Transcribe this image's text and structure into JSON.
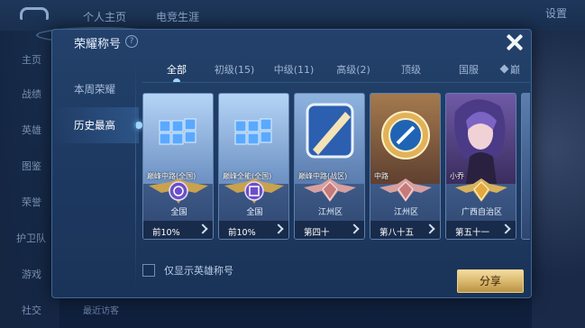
{
  "background": {
    "tabs": [
      "个人主页",
      "电竞生涯"
    ],
    "settings": "设置",
    "side_items": [
      "主页",
      "战绩",
      "英雄",
      "图鉴",
      "荣誉",
      "护卫队",
      "游戏",
      "社交"
    ],
    "bottom_text": "最近访客"
  },
  "modal": {
    "title": "荣耀称号",
    "help": "?",
    "left_nav": [
      {
        "label": "本周荣耀"
      },
      {
        "label": "历史最高"
      }
    ],
    "tabs": [
      {
        "label": "全部"
      },
      {
        "label": "初级(15)"
      },
      {
        "label": "中级(11)"
      },
      {
        "label": "高级(2)"
      },
      {
        "label": "顶级"
      },
      {
        "label": "国服"
      },
      {
        "label": "巅"
      }
    ],
    "cards": [
      {
        "name": "巅峰中路(全国)",
        "region": "全国",
        "rank": "前10%",
        "art": "cube",
        "emblem": "purple"
      },
      {
        "name": "巅峰全能(全国)",
        "region": "全国",
        "rank": "前10%",
        "art": "cube",
        "emblem": "purple"
      },
      {
        "name": "巅峰中路(战区)",
        "region": "江州区",
        "rank": "第四十",
        "art": "slash",
        "emblem": "silver"
      },
      {
        "name": "中路",
        "region": "江州区",
        "rank": "第八十五",
        "art": "medal",
        "emblem": "silver"
      },
      {
        "name": "小乔",
        "region": "广西自治区",
        "rank": "第五十一",
        "art": "hero",
        "emblem": "gold"
      }
    ],
    "checkbox_label": "仅显示英雄称号",
    "share_label": "分享"
  },
  "colors": {
    "accent": "#9fd6ff",
    "share_gold": "#d7b66a",
    "panel": "#1d3860"
  }
}
